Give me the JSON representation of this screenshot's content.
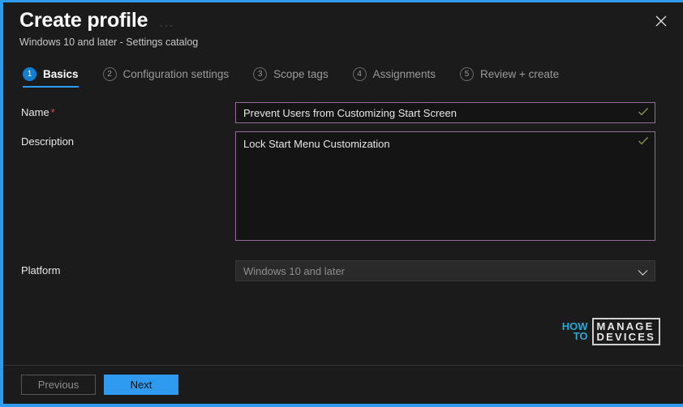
{
  "window": {
    "title": "Create profile",
    "subtitle": "Windows 10 and later - Settings catalog",
    "overflow_menu_label": "...",
    "close_icon": "close-icon",
    "accent_color": "#2e9bf0",
    "background_color": "#1b1b1b"
  },
  "tabs": [
    {
      "number": "1",
      "label": "Basics",
      "active": true
    },
    {
      "number": "2",
      "label": "Configuration settings",
      "active": false
    },
    {
      "number": "3",
      "label": "Scope tags",
      "active": false
    },
    {
      "number": "4",
      "label": "Assignments",
      "active": false
    },
    {
      "number": "5",
      "label": "Review + create",
      "active": false
    }
  ],
  "form": {
    "name": {
      "label": "Name",
      "required_marker": "*",
      "value": "Prevent Users from Customizing Start Screen",
      "placeholder": "",
      "valid_icon": "checkmark-icon",
      "border_color": "#9a68a0",
      "valid_color": "#8a9a4a"
    },
    "description": {
      "label": "Description",
      "value": "Lock Start Menu Customization",
      "placeholder": "",
      "valid_icon": "checkmark-icon",
      "border_color": "#9a68a0",
      "valid_color": "#8a9a4a"
    },
    "platform": {
      "label": "Platform",
      "value": "Windows 10 and later",
      "chevron_icon": "chevron-down-icon",
      "disabled": true
    }
  },
  "watermark": {
    "how": "HOW",
    "to": "TO",
    "manage": "MANAGE",
    "devices": "DEVICES",
    "accent_color": "#29a8d8"
  },
  "footer": {
    "previous_label": "Previous",
    "next_label": "Next"
  }
}
